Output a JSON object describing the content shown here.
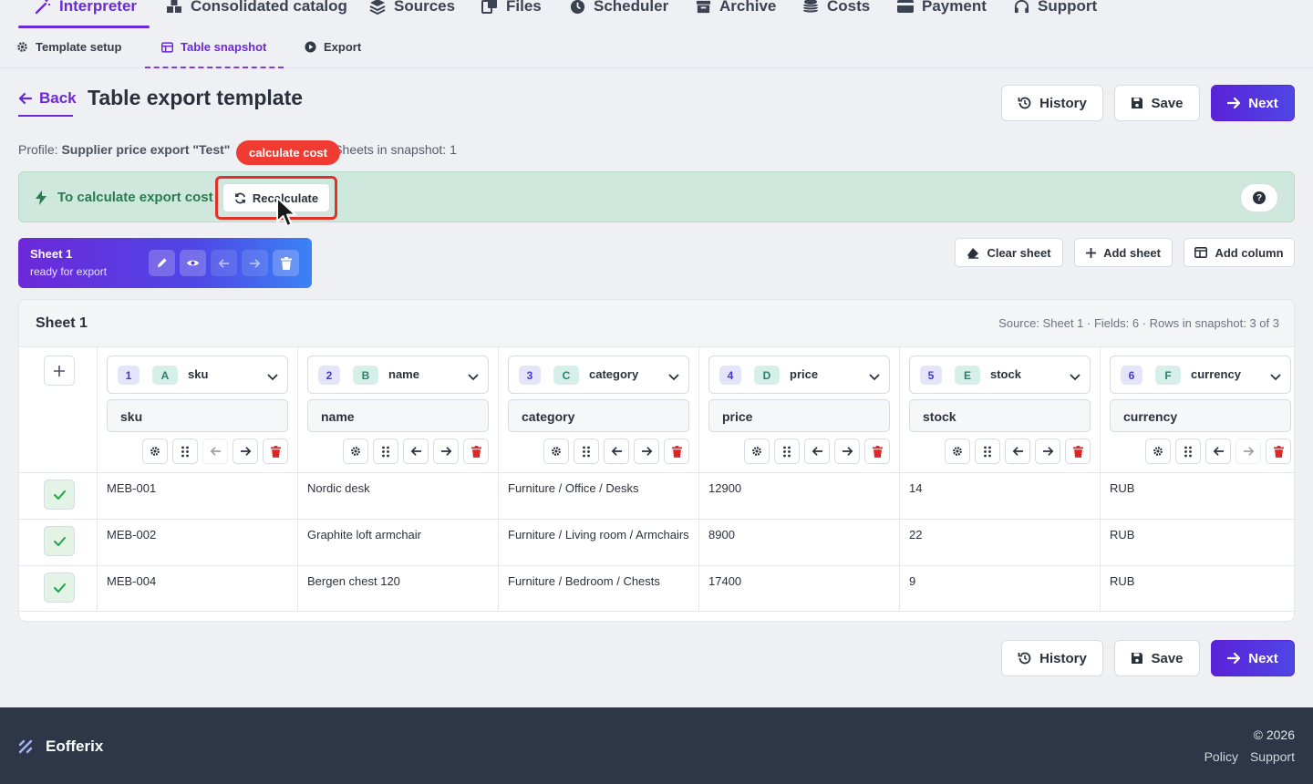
{
  "top_nav": {
    "items": [
      {
        "label": "Interpreter",
        "icon": "wand-icon",
        "active": true
      },
      {
        "label": "Consolidated catalog",
        "icon": "boxes-icon"
      },
      {
        "label": "Sources",
        "icon": "layers-icon"
      },
      {
        "label": "Files",
        "icon": "files-icon"
      },
      {
        "label": "Scheduler",
        "icon": "clock-icon"
      },
      {
        "label": "Archive",
        "icon": "archive-icon"
      },
      {
        "label": "Costs",
        "icon": "coins-icon"
      },
      {
        "label": "Payment",
        "icon": "card-icon"
      },
      {
        "label": "Support",
        "icon": "headset-icon"
      }
    ]
  },
  "sub_tabs": [
    {
      "label": "Template setup",
      "icon": "gear-icon"
    },
    {
      "label": "Table snapshot",
      "icon": "table-icon",
      "active": true
    },
    {
      "label": "Export",
      "icon": "play-icon"
    }
  ],
  "header": {
    "back_label": "Back",
    "title": "Table export template",
    "history_label": "History",
    "save_label": "Save",
    "next_label": "Next"
  },
  "profile": {
    "prefix": "Profile:",
    "name": "Supplier price export \"Test\"",
    "sheets_info": "Sheets in snapshot: 1"
  },
  "tooltip": "calculate cost",
  "banner": {
    "text": "To calculate export cost",
    "recalc_label": "Recalculate",
    "help": "?"
  },
  "sheet_card": {
    "name": "Sheet 1",
    "status": "ready for export"
  },
  "sheet_actions": {
    "clear_label": "Clear sheet",
    "add_sheet_label": "Add sheet",
    "add_column_label": "Add column"
  },
  "panel": {
    "title": "Sheet 1",
    "meta": "Source: Sheet 1 · Fields: 6 · Rows in snapshot: 3 of 3"
  },
  "columns": [
    {
      "num": "1",
      "letter": "A",
      "field": "sku",
      "input": "sku"
    },
    {
      "num": "2",
      "letter": "B",
      "field": "name",
      "input": "name"
    },
    {
      "num": "3",
      "letter": "C",
      "field": "category",
      "input": "category"
    },
    {
      "num": "4",
      "letter": "D",
      "field": "price",
      "input": "price"
    },
    {
      "num": "5",
      "letter": "E",
      "field": "stock",
      "input": "stock"
    },
    {
      "num": "6",
      "letter": "F",
      "field": "currency",
      "input": "currency"
    }
  ],
  "rows": [
    [
      "MEB-001",
      "Nordic desk",
      "Furniture / Office / Desks",
      "12900",
      "14",
      "RUB"
    ],
    [
      "MEB-002",
      "Graphite loft armchair",
      "Furniture / Living room / Armchairs",
      "8900",
      "22",
      "RUB"
    ],
    [
      "MEB-004",
      "Bergen chest 120",
      "Furniture / Bedroom / Chests",
      "17400",
      "9",
      "RUB"
    ]
  ],
  "footer": {
    "brand": "Eofferix",
    "copyright": "© 2026",
    "policy": "Policy",
    "support": "Support"
  },
  "colors": {
    "accent": "#6d28d9",
    "primary_button": "#5b21d6",
    "banner_bg": "#cfe8dd",
    "banner_text": "#2a7a52",
    "danger": "#dc2626",
    "footer_bg": "#2d3748"
  }
}
